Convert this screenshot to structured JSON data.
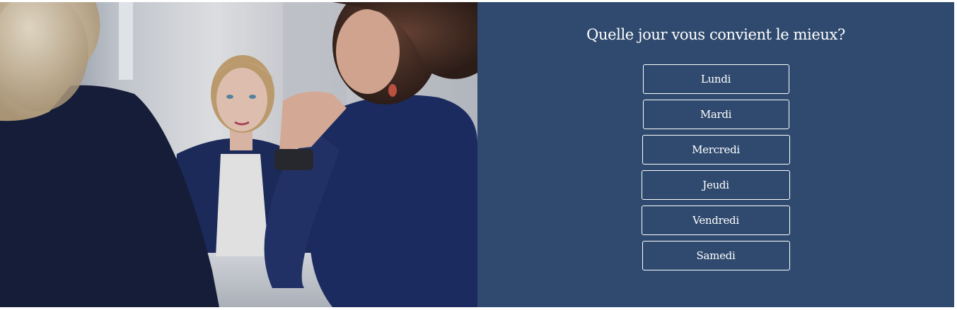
{
  "photo": {
    "image_label": "Three women seated at a table in an interview meeting"
  },
  "survey": {
    "question": "Quelle jour vous convient le mieux?",
    "options": [
      {
        "label": "Lundi"
      },
      {
        "label": "Mardi"
      },
      {
        "label": "Mercredi"
      },
      {
        "label": "Jeudi"
      },
      {
        "label": "Vendredi"
      },
      {
        "label": "Samedi"
      }
    ]
  },
  "colors": {
    "panel_background": "#2f4a6e",
    "button_border": "#ffffff",
    "text": "#ffffff"
  }
}
